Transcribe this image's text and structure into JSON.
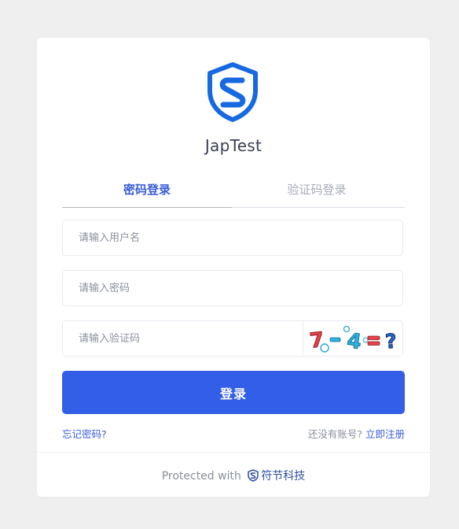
{
  "app": {
    "title": "JapTest",
    "logo_icon": "shield-s-logo-icon"
  },
  "tabs": [
    {
      "label": "密码登录",
      "active": true
    },
    {
      "label": "验证码登录",
      "active": false
    }
  ],
  "form": {
    "username_placeholder": "请输入用户名",
    "username_value": "",
    "password_placeholder": "请输入密码",
    "password_value": "",
    "captcha_placeholder": "请输入验证码",
    "captcha_value": "",
    "captcha_image_text": "7-4=?",
    "login_label": "登录"
  },
  "links": {
    "forgot_password": "忘记密码?",
    "register_prompt": "还没有账号?",
    "register_link": "立即注册"
  },
  "footer": {
    "protected_text": "Protected with",
    "brand_icon": "shield-s-icon",
    "brand_name": "符节科技"
  },
  "colors": {
    "accent": "#335fe8",
    "link": "#3a5dd9",
    "background": "#efefef",
    "logo_blue": "#1669e0"
  }
}
